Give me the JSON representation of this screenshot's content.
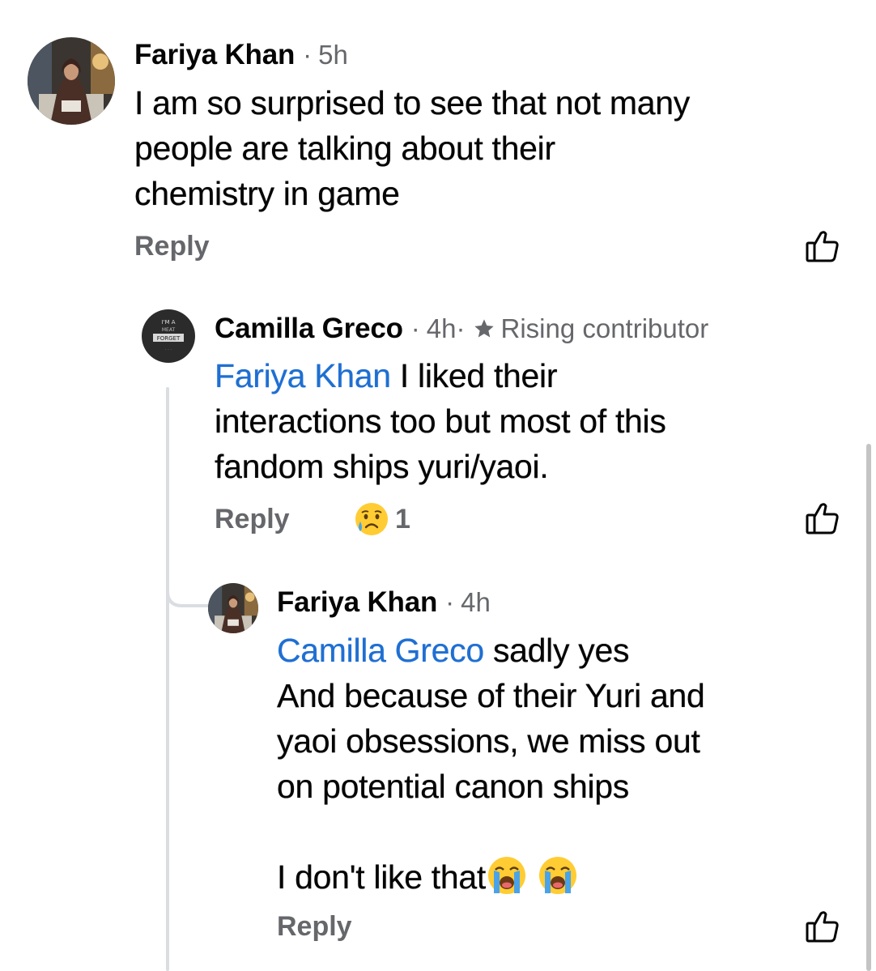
{
  "comments": [
    {
      "author": "Fariya Khan",
      "separator": "·",
      "time": "5h",
      "text": "I am so surprised to see that not many people are talking about their chemistry in game",
      "text_lines": [
        "I am so surprised to see that not many",
        "people are talking about their",
        "chemistry in game"
      ],
      "reply_label": "Reply",
      "like_icon": "thumbs-up-icon",
      "replies": [
        {
          "author": "Camilla Greco",
          "separator": "·",
          "time": "4h·",
          "badge_icon": "star-icon",
          "badge": "Rising contributor",
          "mention": "Fariya Khan",
          "text_lines": [
            "I liked their",
            "interactions too but most of this",
            "fandom ships yuri/yaoi."
          ],
          "reply_label": "Reply",
          "reaction": {
            "icon": "crying-face-emoji",
            "count": "1"
          },
          "like_icon": "thumbs-up-icon"
        },
        {
          "author": "Fariya Khan",
          "separator": "·",
          "time": "4h",
          "mention": "Camilla Greco",
          "text_lines": [
            "sadly yes",
            "And because of their Yuri and",
            "yaoi obsessions, we miss out",
            "on potential canon ships",
            "",
            "I don't like that"
          ],
          "trailing_emojis": [
            "loudly-crying-face-emoji",
            "loudly-crying-face-emoji"
          ],
          "reply_label": "Reply",
          "like_icon": "thumbs-up-icon"
        }
      ]
    }
  ],
  "colors": {
    "text": "#050505",
    "secondary": "#65676b",
    "mention": "#1f6fd2",
    "thread_line": "#dadde1"
  }
}
